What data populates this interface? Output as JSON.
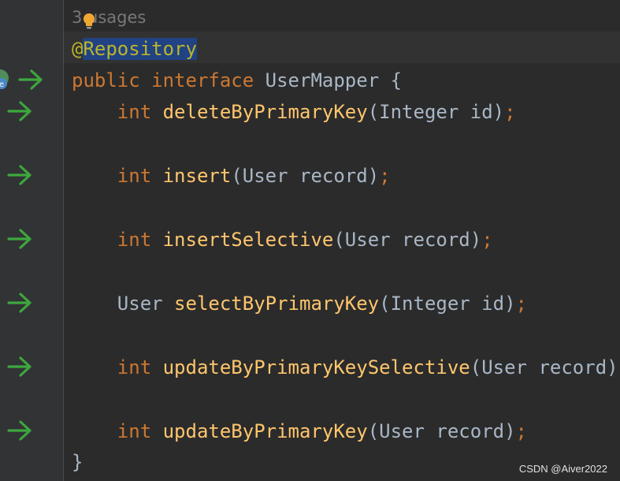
{
  "editor": {
    "usages_hint": "3 usages",
    "annotation": "@Repository",
    "declaration": {
      "modifier": "public",
      "keyword": "interface",
      "name": "UserMapper",
      "open_brace": "{"
    },
    "methods": [
      {
        "return_type": "int",
        "name": "deleteByPrimaryKey",
        "params": "(Integer id)",
        "semicolon": ";"
      },
      {
        "return_type": "int",
        "name": "insert",
        "params": "(User record)",
        "semicolon": ";"
      },
      {
        "return_type": "int",
        "name": "insertSelective",
        "params": "(User record)",
        "semicolon": ";"
      },
      {
        "return_type": "User",
        "name": "selectByPrimaryKey",
        "params": "(Integer id)",
        "semicolon": ";"
      },
      {
        "return_type": "int",
        "name": "updateByPrimaryKeySelective",
        "params": "(User record)",
        "semicolon": ";"
      },
      {
        "return_type": "int",
        "name": "updateByPrimaryKey",
        "params": "(User record)",
        "semicolon": ";"
      }
    ],
    "close_brace": "}"
  },
  "colors": {
    "background": "#2b2b2b",
    "keyword": "#cc7832",
    "method": "#ffc66d",
    "annotation": "#bbb529",
    "selection": "#214283",
    "gutter_arrow": "#3da73d"
  },
  "icons": {
    "bulb": "lightbulb-icon",
    "bean": "spring-bean-icon",
    "nav_arrow": "navigate-arrow-icon"
  },
  "watermark": "CSDN @Aiver2022"
}
